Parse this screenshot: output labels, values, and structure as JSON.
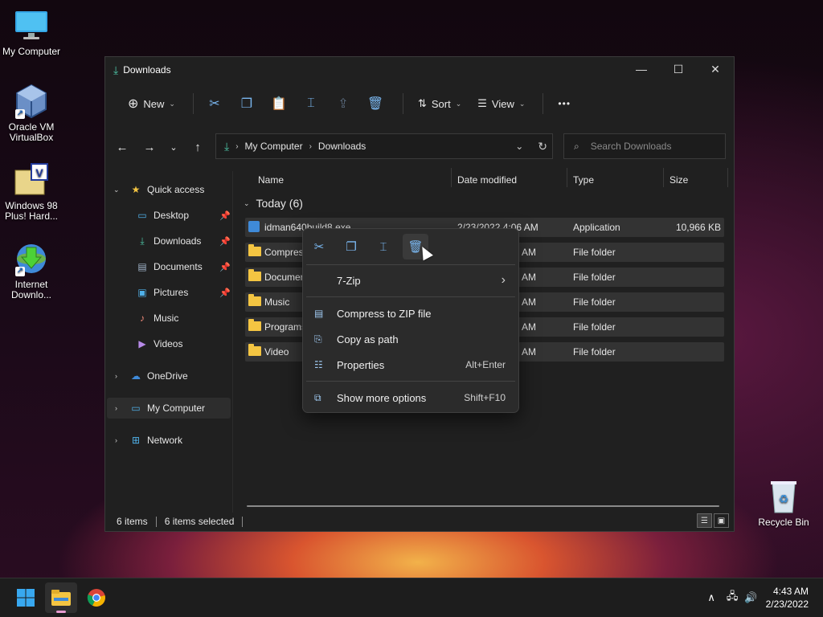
{
  "desktop": {
    "icons": [
      {
        "label": "My Computer"
      },
      {
        "label": "Oracle VM VirtualBox"
      },
      {
        "label": "Windows 98 Plus! Hard..."
      },
      {
        "label": "Internet Downlo..."
      },
      {
        "label": "Recycle Bin"
      }
    ]
  },
  "window": {
    "title": "Downloads",
    "controls": {
      "minimize": "—",
      "maximize": "☐",
      "close": "✕"
    },
    "toolbar": {
      "new_label": "New",
      "sort_label": "Sort",
      "view_label": "View",
      "more_label": "•••"
    },
    "address": {
      "segments": [
        "My Computer",
        "Downloads"
      ]
    },
    "search": {
      "placeholder": "Search Downloads"
    },
    "sidebar": {
      "quick_access": "Quick access",
      "items": [
        "Desktop",
        "Downloads",
        "Documents",
        "Pictures",
        "Music",
        "Videos"
      ],
      "onedrive": "OneDrive",
      "my_computer": "My Computer",
      "network": "Network"
    },
    "columns": {
      "name": "Name",
      "date": "Date modified",
      "type": "Type",
      "size": "Size"
    },
    "group": "Today (6)",
    "rows": [
      {
        "name": "idman640build8.exe",
        "date": "2/23/2022 4:06 AM",
        "type": "Application",
        "size": "10,966 KB"
      },
      {
        "name": "Compress",
        "date": "AM",
        "type": "File folder",
        "size": ""
      },
      {
        "name": "Documen",
        "date": "AM",
        "type": "File folder",
        "size": ""
      },
      {
        "name": "Music",
        "date": "AM",
        "type": "File folder",
        "size": ""
      },
      {
        "name": "Programs",
        "date": "AM",
        "type": "File folder",
        "size": ""
      },
      {
        "name": "Video",
        "date": "AM",
        "type": "File folder",
        "size": ""
      }
    ],
    "status": {
      "items": "6 items",
      "selected": "6 items selected"
    }
  },
  "context_menu": {
    "items": [
      {
        "label": "7-Zip",
        "shortcut": "›"
      },
      {
        "label": "Compress to ZIP file",
        "shortcut": ""
      },
      {
        "label": "Copy as path",
        "shortcut": ""
      },
      {
        "label": "Properties",
        "shortcut": "Alt+Enter"
      },
      {
        "label": "Show more options",
        "shortcut": "Shift+F10"
      }
    ]
  },
  "taskbar": {
    "clock_time": "4:43 AM",
    "clock_date": "2/23/2022"
  },
  "colors": {
    "accent": "#7ab7f0",
    "folder": "#f4c542",
    "window_bg": "#202020"
  }
}
